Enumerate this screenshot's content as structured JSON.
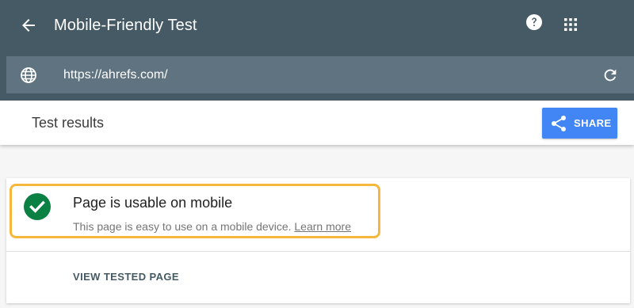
{
  "app": {
    "title": "Mobile-Friendly Test",
    "back_icon": "arrow-back-icon",
    "help_icon": "help-icon",
    "apps_icon": "apps-grid-icon"
  },
  "url_bar": {
    "icon": "globe-icon",
    "value": "https://ahrefs.com/",
    "refresh_icon": "refresh-icon"
  },
  "results": {
    "title": "Test results",
    "share_label": "SHARE",
    "share_icon": "share-icon"
  },
  "verdict": {
    "icon": "check-circle-icon",
    "title": "Page is usable on mobile",
    "description": "This page is easy to use on a mobile device.",
    "learn_more": "Learn more",
    "view_tested_page": "VIEW TESTED PAGE"
  },
  "colors": {
    "topbar": "#455a64",
    "url_bar": "#5f7480",
    "share_button": "#4285f4",
    "success": "#0b8043",
    "highlight": "#f6b73c"
  }
}
